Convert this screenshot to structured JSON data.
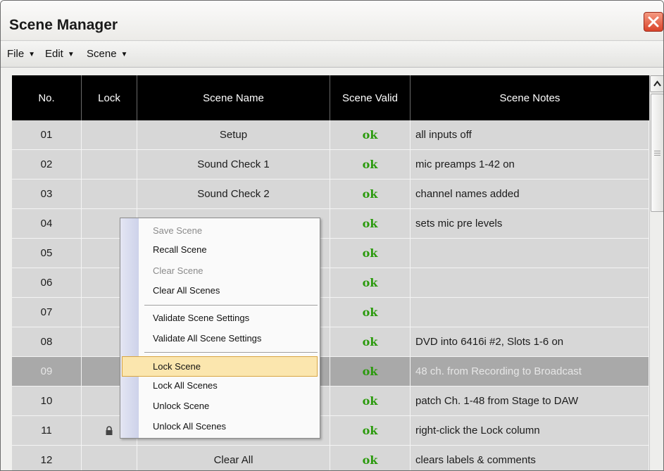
{
  "window": {
    "title": "Scene Manager"
  },
  "menubar": {
    "items": [
      "File",
      "Edit",
      "Scene"
    ]
  },
  "table": {
    "columns": [
      "No.",
      "Lock",
      "Scene Name",
      "Scene Valid",
      "Scene Notes"
    ],
    "rows": [
      {
        "no": "01",
        "lock": "",
        "name": "Setup",
        "valid": "ok",
        "notes": "all inputs off"
      },
      {
        "no": "02",
        "lock": "",
        "name": "Sound Check 1",
        "valid": "ok",
        "notes": "mic preamps 1-42 on"
      },
      {
        "no": "03",
        "lock": "",
        "name": "Sound Check 2",
        "valid": "ok",
        "notes": "channel names added"
      },
      {
        "no": "04",
        "lock": "",
        "name": "",
        "valid": "ok",
        "notes": "sets mic pre levels"
      },
      {
        "no": "05",
        "lock": "",
        "name": "",
        "valid": "ok",
        "notes": ""
      },
      {
        "no": "06",
        "lock": "",
        "name": "",
        "valid": "ok",
        "notes": ""
      },
      {
        "no": "07",
        "lock": "",
        "name": "",
        "valid": "ok",
        "notes": ""
      },
      {
        "no": "08",
        "lock": "",
        "name": "",
        "valid": "ok",
        "notes": "DVD into 6416i #2, Slots 1-6 on"
      },
      {
        "no": "09",
        "lock": "",
        "name": "",
        "valid": "ok",
        "notes": "48 ch. from Recording to Broadcast",
        "selected": true
      },
      {
        "no": "10",
        "lock": "",
        "name": "",
        "valid": "ok",
        "notes": "patch Ch. 1-48 from Stage to DAW"
      },
      {
        "no": "11",
        "lock": "locked",
        "name": "",
        "valid": "ok",
        "notes": "right-click the Lock column"
      },
      {
        "no": "12",
        "lock": "",
        "name": "Clear All",
        "valid": "ok",
        "notes": "clears labels & comments"
      }
    ]
  },
  "context_menu": {
    "items": [
      {
        "label": "Save Scene",
        "enabled": false
      },
      {
        "label": "Recall Scene",
        "enabled": true
      },
      {
        "label": "Clear Scene",
        "enabled": false
      },
      {
        "label": "Clear All Scenes",
        "enabled": true
      },
      {
        "label": "Validate Scene Settings",
        "enabled": true
      },
      {
        "label": "Validate All Scene Settings",
        "enabled": true
      },
      {
        "label": "Lock Scene",
        "enabled": true,
        "highlighted": true
      },
      {
        "label": "Lock All Scenes",
        "enabled": true
      },
      {
        "label": "Unlock Scene",
        "enabled": true
      },
      {
        "label": "Unlock All Scenes",
        "enabled": true
      }
    ]
  },
  "colors": {
    "ok_green": "#2a9a0c",
    "header_bg": "#000000",
    "row_bg": "#d7d7d7",
    "selected_row": "#a9a9a9",
    "highlight": "#fbe6ae"
  }
}
